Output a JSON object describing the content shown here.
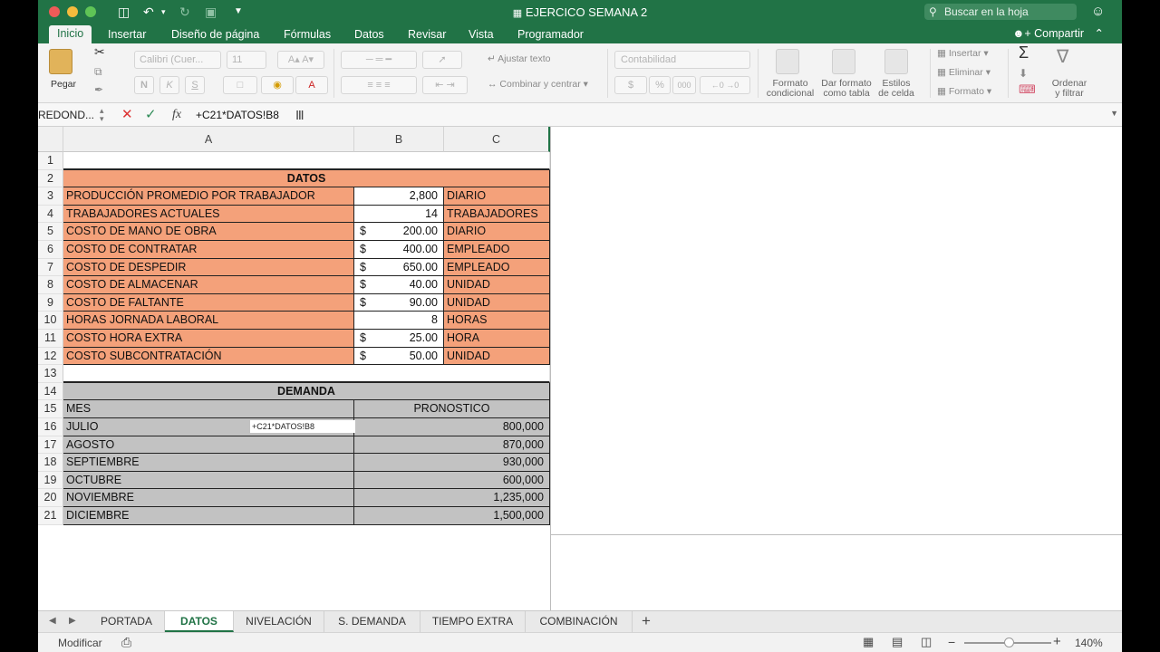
{
  "window": {
    "title": "EJERCICO SEMANA 2",
    "search_placeholder": "Buscar en la hoja",
    "share_label": "Compartir"
  },
  "ribbon_tabs": [
    "Inicio",
    "Insertar",
    "Diseño de página",
    "Fórmulas",
    "Datos",
    "Revisar",
    "Vista",
    "Programador"
  ],
  "ribbon": {
    "paste": "Pegar",
    "font_name": "Calibri (Cuer...",
    "font_size": "11",
    "bold": "N",
    "italic": "K",
    "underline": "S",
    "wrap_text": "Ajustar texto",
    "merge_center": "Combinar y centrar",
    "number_format": "Contabilidad",
    "currency": "$",
    "percent": "%",
    "thousands": "000",
    "conditional_format": [
      "Formato",
      "condicional"
    ],
    "format_table": [
      "Dar formato",
      "como tabla"
    ],
    "cell_styles": [
      "Estilos",
      "de celda"
    ],
    "insert": "Insertar",
    "delete": "Eliminar",
    "format": "Formato",
    "sort_filter": [
      "Ordenar",
      "y filtrar"
    ]
  },
  "formula_bar": {
    "name_box": "REDOND...",
    "fx": "fx",
    "formula": "+C21*DATOS!B8"
  },
  "columns": [
    "A",
    "B",
    "C"
  ],
  "rows": [
    "1",
    "2",
    "3",
    "4",
    "5",
    "6",
    "7",
    "8",
    "9",
    "10",
    "11",
    "12",
    "13",
    "14",
    "15",
    "16",
    "17",
    "18",
    "19",
    "20",
    "21"
  ],
  "datos": {
    "header": "DATOS",
    "items": [
      {
        "label": "PRODUCCIÓN PROMEDIO POR TRABAJADOR",
        "currency": "",
        "value": "2,800",
        "unit": "DIARIO"
      },
      {
        "label": "TRABAJADORES ACTUALES",
        "currency": "",
        "value": "14",
        "unit": "TRABAJADORES"
      },
      {
        "label": "COSTO DE MANO DE OBRA",
        "currency": "$",
        "value": "200.00",
        "unit": "DIARIO"
      },
      {
        "label": "COSTO DE CONTRATAR",
        "currency": "$",
        "value": "400.00",
        "unit": "EMPLEADO"
      },
      {
        "label": "COSTO DE DESPEDIR",
        "currency": "$",
        "value": "650.00",
        "unit": "EMPLEADO"
      },
      {
        "label": "COSTO DE ALMACENAR",
        "currency": "$",
        "value": "40.00",
        "unit": "UNIDAD"
      },
      {
        "label": "COSTO DE FALTANTE",
        "currency": "$",
        "value": "90.00",
        "unit": "UNIDAD"
      },
      {
        "label": "HORAS JORNADA LABORAL",
        "currency": "",
        "value": "8",
        "unit": "HORAS"
      },
      {
        "label": "COSTO HORA EXTRA",
        "currency": "$",
        "value": "25.00",
        "unit": "HORA"
      },
      {
        "label": "COSTO SUBCONTRATACIÓN",
        "currency": "$",
        "value": "50.00",
        "unit": "UNIDAD"
      }
    ]
  },
  "demanda": {
    "header": "DEMANDA",
    "col_mes": "MES",
    "col_pronostico": "PRONOSTICO",
    "items": [
      {
        "mes": "JULIO",
        "pronostico": "800,000"
      },
      {
        "mes": "AGOSTO",
        "pronostico": "870,000"
      },
      {
        "mes": "SEPTIEMBRE",
        "pronostico": "930,000"
      },
      {
        "mes": "OCTUBRE",
        "pronostico": "600,000"
      },
      {
        "mes": "NOVIEMBRE",
        "pronostico": "1,235,000"
      },
      {
        "mes": "DICIEMBRE",
        "pronostico": "1,500,000"
      }
    ],
    "tooltip": "+C21*DATOS!B8"
  },
  "sheet_tabs": [
    "PORTADA",
    "DATOS",
    "NIVELACIÓN",
    "S. DEMANDA",
    "TIEMPO EXTRA",
    "COMBINACIÓN"
  ],
  "active_sheet": "DATOS",
  "status": {
    "mode": "Modificar",
    "zoom": "140%"
  },
  "colors": {
    "accent": "#217346",
    "datos_fill": "#f4a17a",
    "demanda_fill": "#c2c2c2"
  }
}
